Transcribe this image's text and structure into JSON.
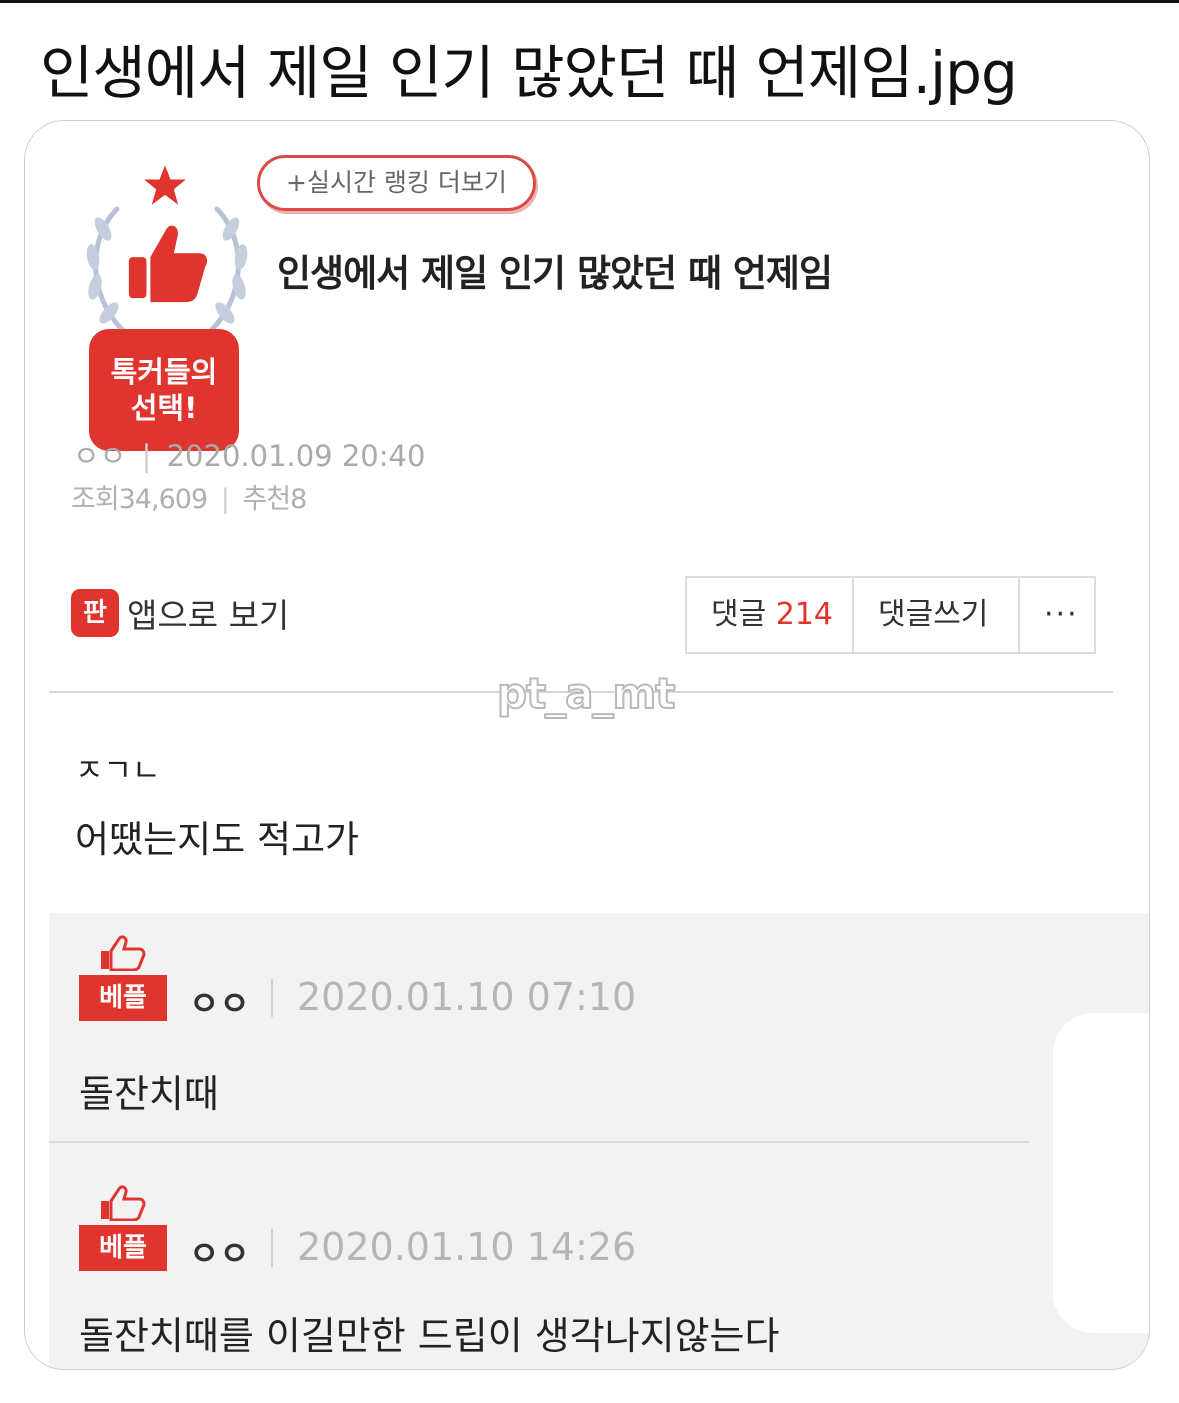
{
  "meme_title": "인생에서 제일 인기 많았던 때 언제임.jpg",
  "badge": {
    "line1": "톡커들의",
    "line2": "선택!"
  },
  "ranking_pill": "+실시간 랭킹 더보기",
  "post": {
    "title": "인생에서 제일 인기 많았던 때 언제임",
    "author": "ㅇㅇ",
    "datetime": "2020.01.09 20:40",
    "views_label": "조회34,609",
    "recommend_label": "추천8",
    "body_line1": "ㅈㄱㄴ",
    "body_line2": "어땠는지도 적고가"
  },
  "toolbar": {
    "app_icon_glyph": "판",
    "app_view_label": "앱으로 보기",
    "comment_label": "댓글",
    "comment_count": "214",
    "write_comment_label": "댓글쓰기",
    "more_label": "···"
  },
  "watermark": "pt_a_mt",
  "comments": [
    {
      "badge": "베플",
      "author": "ㅇㅇ",
      "datetime": "2020.01.10 07:10",
      "text": "돌잔치때"
    },
    {
      "badge": "베플",
      "author": "ㅇㅇ",
      "datetime": "2020.01.10 14:26",
      "text": "돌잔치때를 이길만한 드립이 생각나지않는다"
    }
  ],
  "colors": {
    "accent": "#e0352e",
    "muted_text": "#aaaaaa",
    "comment_bg": "#f2f2f2"
  },
  "icons": [
    "star-icon",
    "laurel-icon",
    "thumbs-up-icon",
    "more-icon"
  ]
}
